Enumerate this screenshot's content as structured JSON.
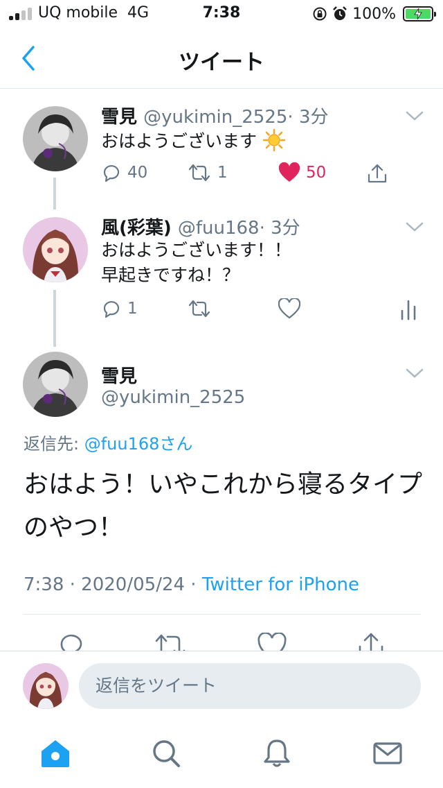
{
  "status_bar": {
    "carrier": "UQ mobile",
    "network": "4G",
    "time": "7:38",
    "battery": "100%",
    "icons": [
      "signal-icon",
      "rotation-lock-icon",
      "alarm-icon",
      "battery-charging-icon"
    ]
  },
  "nav": {
    "title": "ツイート",
    "back_icon": "chevron-left-icon"
  },
  "tweets": [
    {
      "name": "雪見",
      "handle": "@yukimin_2525",
      "time": "· 3分",
      "text": "おはようございます",
      "emoji": "sun-emoji",
      "reply_count": "40",
      "retweet_count": "1",
      "like_count": "50",
      "liked": true
    },
    {
      "name": "風(彩葉)",
      "handle": "@fuu168",
      "time": "· 3分",
      "text_lines": [
        "おはようございます！！",
        "早起きですね！？"
      ],
      "reply_count": "1"
    }
  ],
  "main_tweet": {
    "name": "雪見",
    "handle": "@yukimin_2525",
    "reply_to_label": "返信先: ",
    "reply_to_user": "@fuu168さん",
    "text": "おはよう！いやこれから寝るタイプのやつ！",
    "time": "7:38",
    "date": " · 2020/05/24 · ",
    "source": "Twitter for iPhone"
  },
  "reply_bar": {
    "placeholder": "返信をツイート"
  },
  "tab_bar": [
    "home-icon",
    "search-icon",
    "notifications-icon",
    "messages-icon"
  ],
  "colors": {
    "accent": "#1da1f2",
    "like": "#e0245e",
    "muted": "#657786",
    "divider": "#e1e8ed",
    "input_bg": "#e6ecf0"
  }
}
